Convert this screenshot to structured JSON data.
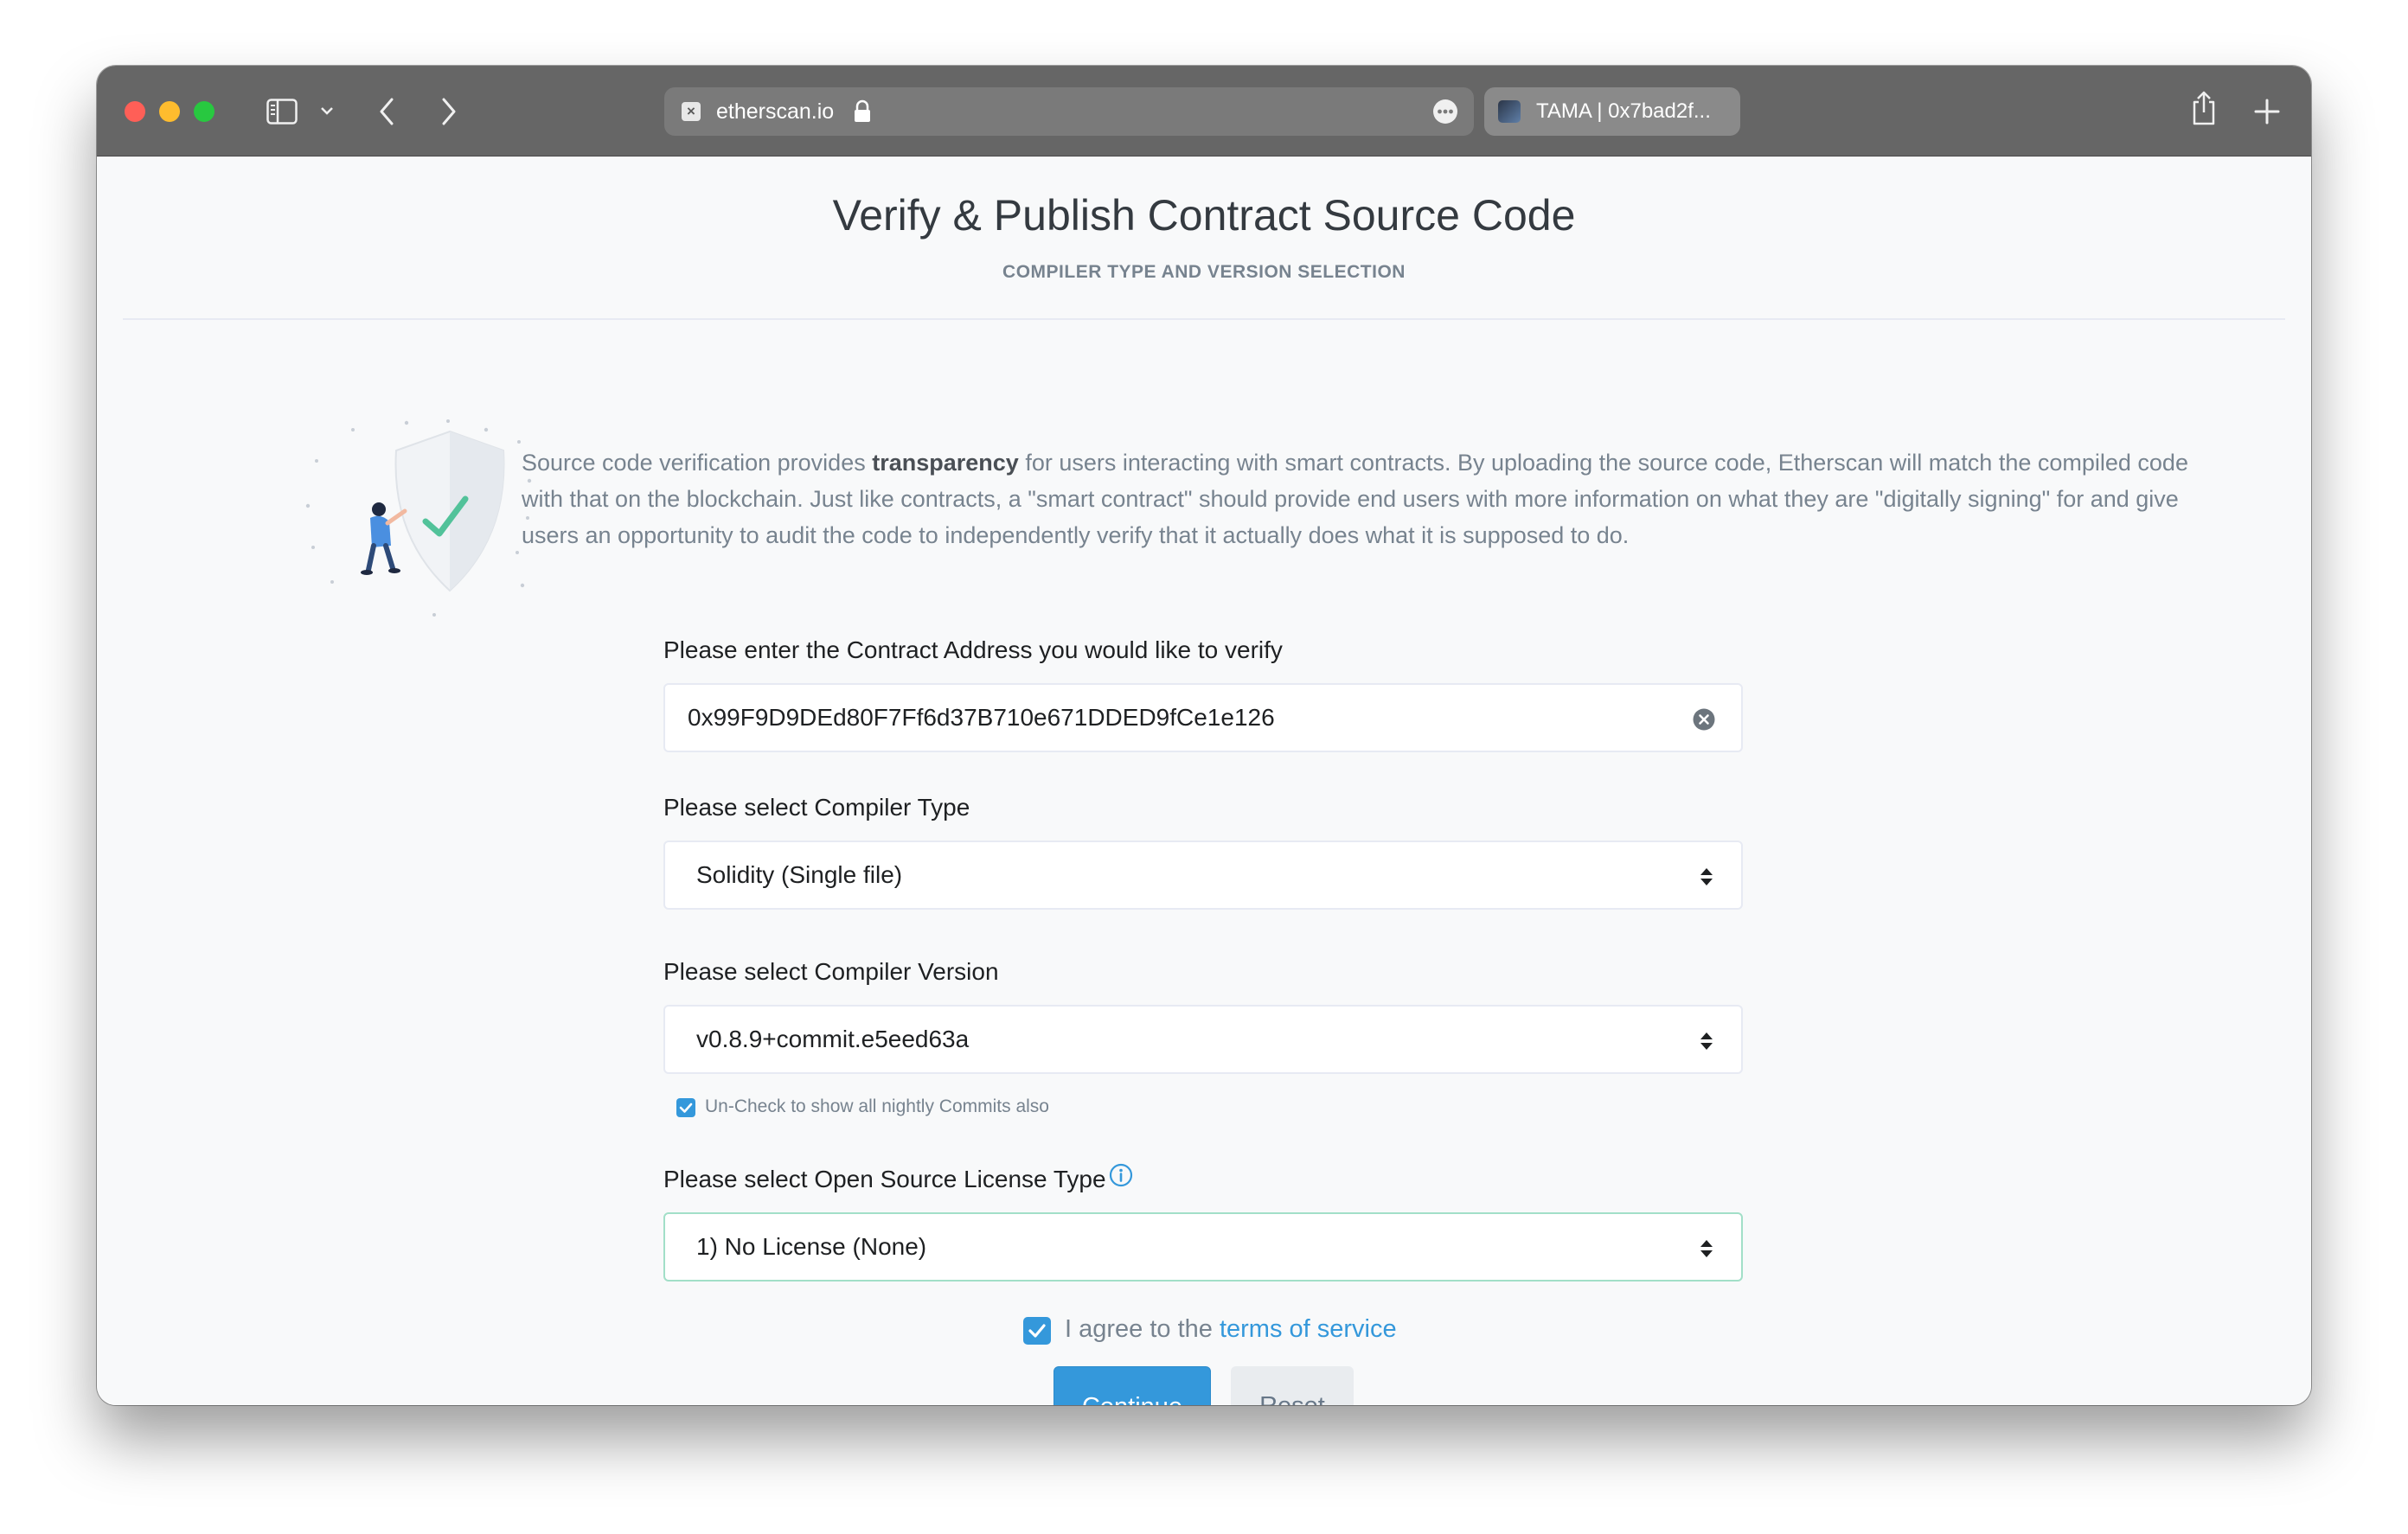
{
  "browser": {
    "address_bar": {
      "url": "etherscan.io"
    },
    "tab": {
      "title": "TAMA | 0x7bad2f..."
    }
  },
  "page": {
    "title": "Verify & Publish Contract Source Code",
    "subtitle": "COMPILER TYPE AND VERSION SELECTION",
    "intro": {
      "before": "Source code verification provides ",
      "bold": "transparency",
      "after": " for users interacting with smart contracts. By uploading the source code, Etherscan will match the compiled code with that on the blockchain. Just like contracts, a \"smart contract\" should provide end users with more information on what they are \"digitally signing\" for and give users an opportunity to audit the code to independently verify that it actually does what it is supposed to do."
    }
  },
  "form": {
    "address": {
      "label": "Please enter the Contract Address you would like to verify",
      "value": "0x99F9D9DEd80F7Ff6d37B710e671DDED9fCe1e126"
    },
    "compiler_type": {
      "label": "Please select Compiler Type",
      "selected": "Solidity (Single file)"
    },
    "compiler_version": {
      "label": "Please select Compiler Version",
      "selected": "v0.8.9+commit.e5eed63a",
      "nightly_checkbox_label": "Un-Check to show all nightly Commits also",
      "nightly_checked": true
    },
    "license": {
      "label": "Please select Open Source License Type",
      "selected": "1) No License (None)"
    },
    "agree": {
      "checked": true,
      "text": "I agree to the ",
      "link": "terms of service"
    },
    "buttons": {
      "continue": "Continue",
      "reset": "Reset"
    }
  },
  "colors": {
    "accent": "#3498db",
    "toolbar": "#666666",
    "focus_border": "#a2dfc8",
    "muted_text": "#77838f"
  },
  "icons": [
    "close-window-icon",
    "minimize-icon",
    "zoom-icon",
    "sidebar-icon",
    "chevron-down-icon",
    "back-icon",
    "forward-icon",
    "site-favicon-icon",
    "lock-icon",
    "more-icon",
    "share-icon",
    "new-tab-icon",
    "clear-icon",
    "select-arrows-icon",
    "info-icon",
    "checkmark-icon"
  ]
}
